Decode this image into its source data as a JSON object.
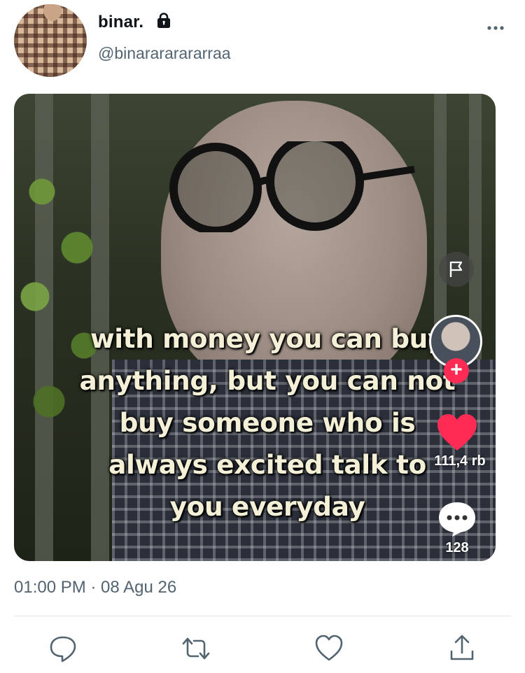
{
  "tweet": {
    "author": {
      "display_name": "binar.",
      "handle": "@binarararararraa",
      "protected_icon": "lock-icon",
      "avatar": "plaid-shirt-avatar"
    },
    "menu_icon": "more-horizontal-icon",
    "media": {
      "caption": "with money you can buy anything, but you can not buy someone who is always excited talk to you everyday",
      "overlay": {
        "flag_icon": "flag-icon",
        "follow_icon": "plus-icon",
        "like_icon": "heart-icon",
        "like_count": "111,4 rb",
        "comment_icon": "comment-bubble-icon",
        "comment_count": "128"
      },
      "accent_color": "#fe2c55"
    },
    "timestamp": "01:00 PM · 08 Agu 26",
    "actions": [
      {
        "name": "reply",
        "icon": "reply-icon"
      },
      {
        "name": "retweet",
        "icon": "retweet-icon"
      },
      {
        "name": "like",
        "icon": "like-icon"
      },
      {
        "name": "share",
        "icon": "share-icon"
      }
    ]
  }
}
